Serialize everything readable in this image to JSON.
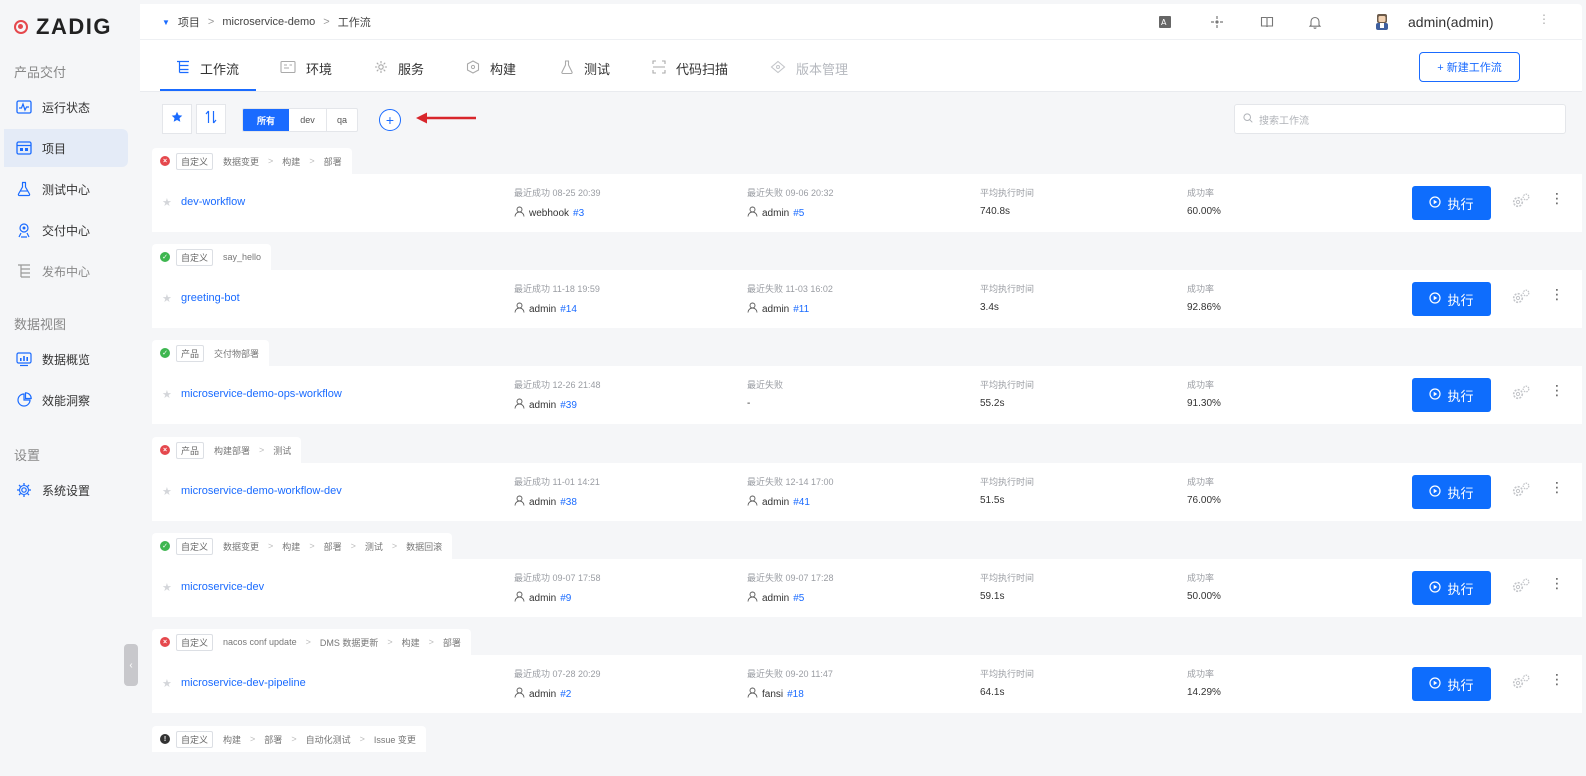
{
  "brand": {
    "name": "ZADIG"
  },
  "sidebar": {
    "sections": [
      {
        "title": "产品交付",
        "items": [
          {
            "label": "运行状态",
            "icon": "activity-icon"
          },
          {
            "label": "项目",
            "icon": "project-icon",
            "active": true
          },
          {
            "label": "测试中心",
            "icon": "flask-icon"
          },
          {
            "label": "交付中心",
            "icon": "delivery-icon"
          },
          {
            "label": "发布中心",
            "icon": "release-icon"
          }
        ]
      },
      {
        "title": "数据视图",
        "items": [
          {
            "label": "数据概览",
            "icon": "chart-icon"
          },
          {
            "label": "效能洞察",
            "icon": "pie-icon"
          }
        ]
      },
      {
        "title": "设置",
        "items": [
          {
            "label": "系统设置",
            "icon": "gear-icon"
          }
        ]
      }
    ]
  },
  "breadcrumb": {
    "items": [
      "项目",
      "microservice-demo",
      "工作流"
    ]
  },
  "user": {
    "name": "admin(admin)"
  },
  "tabs": [
    {
      "label": "工作流",
      "active": true
    },
    {
      "label": "环境"
    },
    {
      "label": "服务"
    },
    {
      "label": "构建"
    },
    {
      "label": "测试"
    },
    {
      "label": "代码扫描"
    },
    {
      "label": "版本管理",
      "disabled": true
    }
  ],
  "new_workflow_button": "+ 新建工作流",
  "filters": {
    "options": [
      "所有",
      "dev",
      "qa"
    ],
    "selected": "所有"
  },
  "search": {
    "placeholder": "搜索工作流"
  },
  "run_label": "执行",
  "workflows": [
    {
      "status": "fail",
      "tag": "自定义",
      "stages": [
        "数据变更",
        "构建",
        "部署"
      ],
      "name": "dev-workflow",
      "last_success_label": "最近成功 08-25 20:39",
      "last_success_user": "webhook",
      "last_success_num": "#3",
      "last_fail_label": "最近失败 09-06 20:32",
      "last_fail_user": "admin",
      "last_fail_num": "#5",
      "avg_label": "平均执行时间",
      "avg": "740.8s",
      "rate_label": "成功率",
      "rate": "60.00%"
    },
    {
      "status": "ok",
      "tag": "自定义",
      "stages": [
        "say_hello"
      ],
      "name": "greeting-bot",
      "last_success_label": "最近成功 11-18 19:59",
      "last_success_user": "admin",
      "last_success_num": "#14",
      "last_fail_label": "最近失败 11-03 16:02",
      "last_fail_user": "admin",
      "last_fail_num": "#11",
      "avg_label": "平均执行时间",
      "avg": "3.4s",
      "rate_label": "成功率",
      "rate": "92.86%"
    },
    {
      "status": "ok",
      "tag": "产品",
      "stages": [
        "交付物部署"
      ],
      "name": "microservice-demo-ops-workflow",
      "last_success_label": "最近成功 12-26 21:48",
      "last_success_user": "admin",
      "last_success_num": "#39",
      "last_fail_label": "最近失败",
      "last_fail_user": "",
      "last_fail_num": "-",
      "avg_label": "平均执行时间",
      "avg": "55.2s",
      "rate_label": "成功率",
      "rate": "91.30%"
    },
    {
      "status": "fail",
      "tag": "产品",
      "stages": [
        "构建部署",
        "测试"
      ],
      "name": "microservice-demo-workflow-dev",
      "last_success_label": "最近成功 11-01 14:21",
      "last_success_user": "admin",
      "last_success_num": "#38",
      "last_fail_label": "最近失败 12-14 17:00",
      "last_fail_user": "admin",
      "last_fail_num": "#41",
      "avg_label": "平均执行时间",
      "avg": "51.5s",
      "rate_label": "成功率",
      "rate": "76.00%"
    },
    {
      "status": "ok",
      "tag": "自定义",
      "stages": [
        "数据变更",
        "构建",
        "部署",
        "测试",
        "数据回滚"
      ],
      "name": "microservice-dev",
      "last_success_label": "最近成功 09-07 17:58",
      "last_success_user": "admin",
      "last_success_num": "#9",
      "last_fail_label": "最近失败 09-07 17:28",
      "last_fail_user": "admin",
      "last_fail_num": "#5",
      "avg_label": "平均执行时间",
      "avg": "59.1s",
      "rate_label": "成功率",
      "rate": "50.00%"
    },
    {
      "status": "fail",
      "tag": "自定义",
      "stages": [
        "nacos conf update",
        "DMS 数据更新",
        "构建",
        "部署"
      ],
      "name": "microservice-dev-pipeline",
      "last_success_label": "最近成功 07-28 20:29",
      "last_success_user": "admin",
      "last_success_num": "#2",
      "last_fail_label": "最近失败 09-20 11:47",
      "last_fail_user": "fansi",
      "last_fail_num": "#18",
      "avg_label": "平均执行时间",
      "avg": "64.1s",
      "rate_label": "成功率",
      "rate": "14.29%"
    },
    {
      "status": "pend",
      "tag": "自定义",
      "stages": [
        "构建",
        "部署",
        "自动化测试",
        "Issue 变更"
      ],
      "name": "",
      "partial": true
    }
  ]
}
